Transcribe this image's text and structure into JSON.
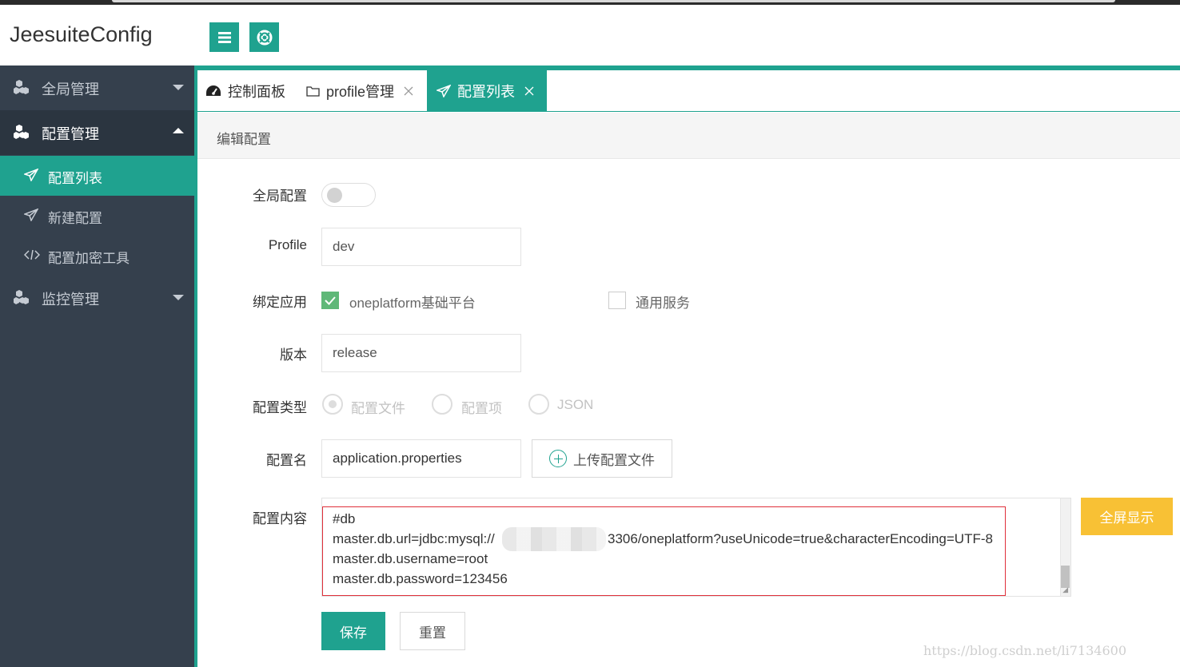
{
  "app": {
    "brand": "JeesuiteConfig"
  },
  "header": {
    "menu_icon": "hamburger-icon",
    "help_icon": "lifebuoy-icon",
    "accent": "#1fa28f"
  },
  "sidebar": {
    "groups": [
      {
        "label": "全局管理",
        "icon": "cubes-icon",
        "state": "collapsed"
      },
      {
        "label": "配置管理",
        "icon": "cubes-icon",
        "state": "expanded",
        "items": [
          {
            "label": "配置列表",
            "icon": "paper-plane-icon",
            "active": true
          },
          {
            "label": "新建配置",
            "icon": "paper-plane-icon",
            "active": false
          },
          {
            "label": "配置加密工具",
            "icon": "code-icon",
            "active": false
          }
        ]
      },
      {
        "label": "监控管理",
        "icon": "cubes-icon",
        "state": "collapsed"
      }
    ]
  },
  "tabs": [
    {
      "label": "控制面板",
      "icon": "dashboard-icon",
      "closable": false,
      "active": false
    },
    {
      "label": "profile管理",
      "icon": "folder-icon",
      "closable": true,
      "active": false
    },
    {
      "label": "配置列表",
      "icon": "paper-plane-icon",
      "closable": true,
      "active": true
    }
  ],
  "panel": {
    "title": "编辑配置"
  },
  "form": {
    "global": {
      "label": "全局配置",
      "on": false
    },
    "profile": {
      "label": "Profile",
      "value": "dev"
    },
    "bind_app": {
      "label": "绑定应用",
      "options": [
        {
          "label": "oneplatform基础平台",
          "checked": true
        },
        {
          "label": "通用服务",
          "checked": false
        }
      ]
    },
    "version": {
      "label": "版本",
      "value": "release"
    },
    "config_type": {
      "label": "配置类型",
      "options": [
        {
          "label": "配置文件",
          "selected": true
        },
        {
          "label": "配置项",
          "selected": false
        },
        {
          "label": "JSON",
          "selected": false
        }
      ]
    },
    "config_name": {
      "label": "配置名",
      "value": "application.properties",
      "upload_label": "上传配置文件"
    },
    "content": {
      "label": "配置内容",
      "lines": [
        "#db",
        "master.db.url=jdbc:mysql://",
        "3306/oneplatform?useUnicode=true&characterEncoding=UTF-8",
        "master.db.username=root",
        "master.db.password=123456"
      ],
      "fullscreen_label": "全屏显示"
    },
    "actions": {
      "save": "保存",
      "reset": "重置"
    }
  },
  "watermark": "https://blog.csdn.net/li7134600"
}
